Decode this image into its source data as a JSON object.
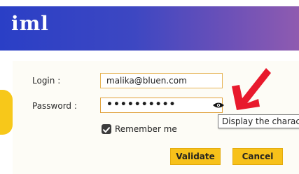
{
  "banner": {
    "logo_text": "iml",
    "gradient_start": "#2a3fc6",
    "gradient_end": "#8f5bb0"
  },
  "form": {
    "login_label": "Login :",
    "login_value": "malika@bluen.com",
    "password_label": "Password :",
    "password_value": "••••••••••",
    "remember_label": "Remember me",
    "remember_checked": true,
    "tooltip": "Display the characters"
  },
  "buttons": {
    "validate_label": "Validate",
    "cancel_label": "Cancel"
  },
  "icons": {
    "eye": "eye-icon",
    "checkbox": "checkmark-icon",
    "annotation": "red-arrow-icon"
  },
  "colors": {
    "accent": "#f7c11a",
    "annotation": "#e8192c"
  }
}
